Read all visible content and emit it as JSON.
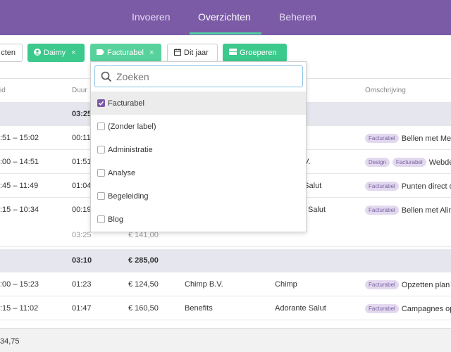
{
  "nav": {
    "tabs": [
      "Invoeren",
      "Overzichten",
      "Beheren"
    ],
    "active": "Overzichten"
  },
  "filters": {
    "cut_button": "cten",
    "user_chip": "Daimy",
    "label_chip": "Facturabel",
    "period_button": "Dit jaar",
    "group_button": "Groeperen",
    "remove_symbol": "×"
  },
  "columns": {
    "tijd": "id",
    "duur": "Duur",
    "omschrijving": "Omschrijving"
  },
  "rows": [
    {
      "kind": "group",
      "duur": "03:25"
    },
    {
      "kind": "entry",
      "tijd": ":51 – 15:02",
      "duur": "00:11",
      "klant": "",
      "project": "",
      "tags": [
        "Facturabel"
      ],
      "omschrijving": "Bellen met Mel"
    },
    {
      "kind": "entry",
      "tijd": ":00 – 14:51",
      "duur": "01:51",
      "klant": "",
      "project": "3.V.",
      "tags": [
        "Design",
        "Facturabel"
      ],
      "omschrijving": "Webde"
    },
    {
      "kind": "entry",
      "tijd": ":45 – 11:49",
      "duur": "01:04",
      "klant": "",
      "project": "e Salut",
      "tags": [
        "Facturabel"
      ],
      "omschrijving": "Punten direct o"
    },
    {
      "kind": "entry",
      "tijd": ":15 – 10:34",
      "duur": "00:19",
      "klant": "",
      "project": "Salut",
      "tags": [
        "Facturabel"
      ],
      "omschrijving": "Bellen met Alin"
    },
    {
      "kind": "subtotal",
      "duur": "03:25",
      "bedrag": "€ 141,00"
    },
    {
      "kind": "group",
      "duur": "03:10",
      "bedrag": "€ 285,00"
    },
    {
      "kind": "entry",
      "tijd": ":00 – 15:23",
      "duur": "01:23",
      "bedrag": "€ 124,50",
      "klant": "Chimp B.V.",
      "project": "Chimp",
      "tags": [
        "Facturabel"
      ],
      "omschrijving": "Opzetten plan"
    },
    {
      "kind": "entry",
      "tijd": ":15 – 11:02",
      "duur": "01:47",
      "bedrag": "€ 160,50",
      "klant": "Benefits",
      "project": "Adorante Salut",
      "tags": [
        "Facturabel"
      ],
      "omschrijving": "Campagnes op"
    }
  ],
  "footer": {
    "total": "34,75"
  },
  "dropdown": {
    "search_placeholder": "Zoeken",
    "options": [
      {
        "label": "Facturabel",
        "checked": true
      },
      {
        "label": "(Zonder label)",
        "checked": false
      },
      {
        "label": "Administratie",
        "checked": false
      },
      {
        "label": "Analyse",
        "checked": false
      },
      {
        "label": "Begeleiding",
        "checked": false
      },
      {
        "label": "Blog",
        "checked": false
      }
    ]
  },
  "colors": {
    "nav": "#7b5aa6",
    "accent": "#3cc98c",
    "tag_bg": "#e2d9ef",
    "tag_text": "#7a5fa3"
  }
}
